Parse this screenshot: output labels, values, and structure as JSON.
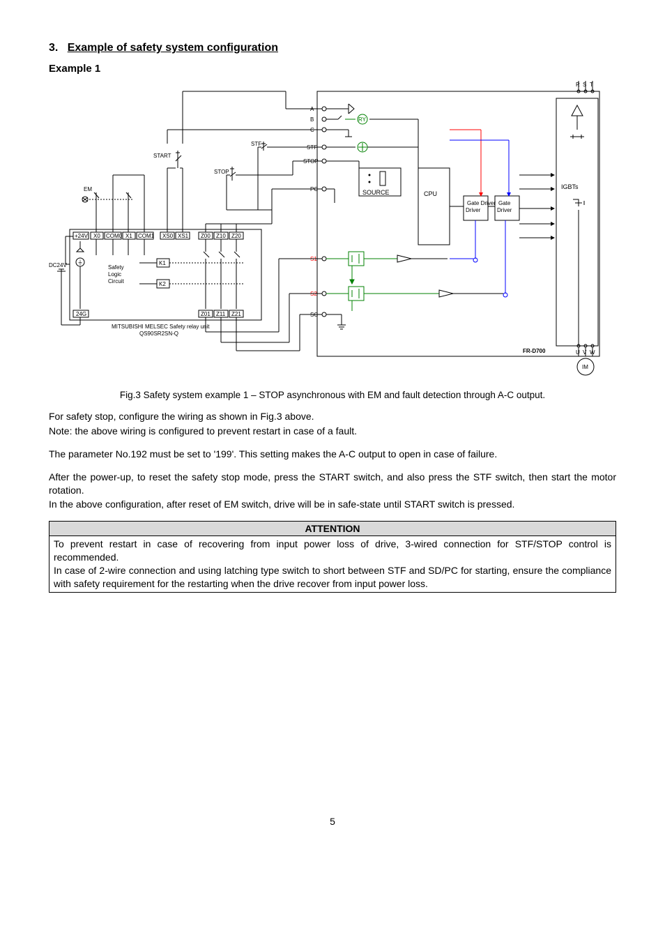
{
  "section": {
    "number": "3.",
    "title": "Example of safety system configuration"
  },
  "example_label": "Example 1",
  "diagram": {
    "external": {
      "start": "START",
      "stf_sw": "STF",
      "stop_sw": "STOP",
      "em": "EM",
      "dc24v": "DC24V"
    },
    "relay_unit": {
      "terminals_top": [
        "+24V",
        "X0",
        "COM0",
        "X1",
        "COM1",
        "XS0",
        "XS1",
        "Z00",
        "Z10",
        "Z20"
      ],
      "terminals_bottom": [
        "24G",
        "Z01",
        "Z11",
        "Z21"
      ],
      "k1": "K1",
      "k2": "K2",
      "logic": "Safety\nLogic\nCircuit",
      "caption": "MITSUBISHI MELSEC Safety relay unit\nQS90SR2SN-Q"
    },
    "drive": {
      "name": "FR-D700",
      "terminals": [
        "A",
        "B",
        "C",
        "STF",
        "STOP",
        "PC",
        "S1",
        "S2",
        "SC"
      ],
      "ry": "RY",
      "source": "SOURCE",
      "cpu": "CPU",
      "gate1": "Gate\nDriver",
      "gate2": "Gate\nDriver",
      "igbts": "IGBTs",
      "power_in": [
        "R",
        "S",
        "T"
      ],
      "power_out": [
        "U",
        "V",
        "W"
      ],
      "motor": "IM"
    }
  },
  "caption": "Fig.3 Safety system example 1 – STOP asynchronous with EM and fault detection through A-C output.",
  "body": {
    "p1": "For safety stop, configure the wiring as shown in Fig.3 above.",
    "p2": "Note: the above wiring is configured to prevent restart in case of a fault.",
    "p3": "The parameter No.192 must be set to '199'. This setting makes the A-C output to open in case of failure.",
    "p4": "After the power-up, to reset the safety stop mode, press the START switch, and also press the STF switch, then start the motor rotation.",
    "p5": "In the above configuration, after reset of EM switch, drive will be in safe-state until START switch is pressed."
  },
  "attention": {
    "header": "ATTENTION",
    "text": "To prevent restart in case of recovering from input power loss of drive, 3-wired connection for STF/STOP control is recommended.\nIn case of 2-wire connection and using latching type switch to short between STF and SD/PC for starting, ensure the compliance with safety requirement for the restarting when the drive recover from input power loss."
  },
  "page_number": "5"
}
